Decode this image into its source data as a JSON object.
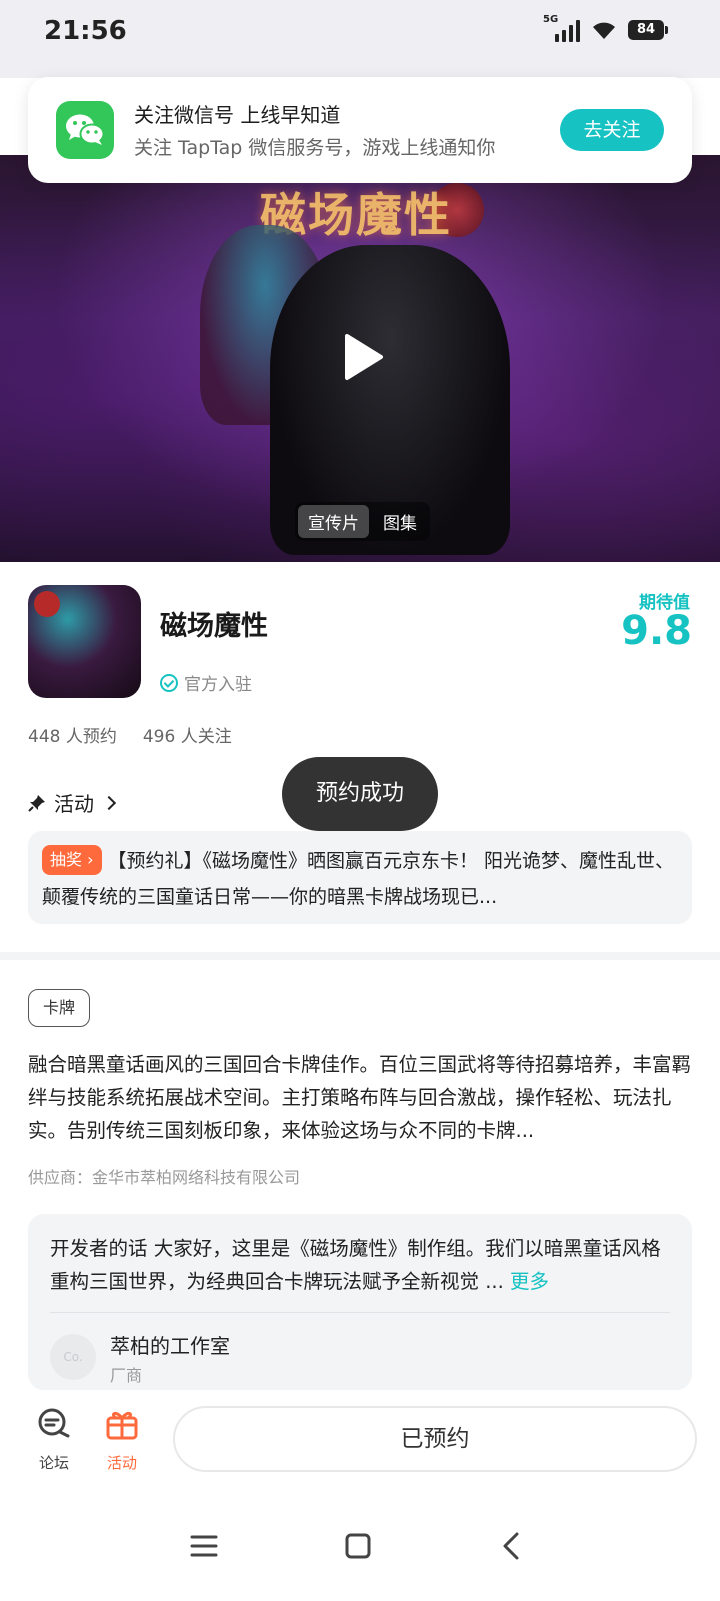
{
  "status_bar": {
    "time": "21:56",
    "network": "5G",
    "battery": "84"
  },
  "notice": {
    "title": "关注微信号 上线早知道",
    "subtitle": "关注 TapTap 微信服务号，游戏上线通知你",
    "button": "去关注"
  },
  "hero": {
    "art_title": "磁场魔性",
    "tabs": [
      "宣传片",
      "图集"
    ],
    "active_tab": "宣传片"
  },
  "app": {
    "name": "磁场魔性",
    "official_label": "官方入驻",
    "expectation_label": "期待值",
    "expectation_score": "9.8",
    "reservations": "448 人预约",
    "followers": "496 人关注"
  },
  "toast": "预约成功",
  "activity": {
    "heading": "活动",
    "badge": "抽奖",
    "text": "【预约礼】《磁场魔性》晒图赢百元京东卡！ 阳光诡梦、魔性乱世、颠覆传统的三国童话日常——你的暗黑卡牌战场现已..."
  },
  "details": {
    "tag": "卡牌",
    "description": "融合暗黑童话画风的三国回合卡牌佳作。百位三国武将等待招募培养，丰富羁绊与技能系统拓展战术空间。主打策略布阵与回合激战，操作轻松、玩法扎实。告别传统三国刻板印象，来体验这场与众不同的卡牌...",
    "supplier": "供应商：金华市萃柏网络科技有限公司"
  },
  "developer": {
    "text": "开发者的话  大家好，这里是《磁场魔性》制作组。我们以暗黑童话风格重构三国世界，为经典回合卡牌玩法赋予全新视觉 ...",
    "more": "更多",
    "avatar_text": "Co.",
    "name": "萃柏的工作室",
    "role": "厂商"
  },
  "bottom_bar": {
    "forum": "论坛",
    "activity": "活动",
    "reserved": "已预约"
  },
  "colors": {
    "accent": "#16c2c2",
    "orange": "#ff6a3d",
    "wechat": "#33c75a"
  }
}
